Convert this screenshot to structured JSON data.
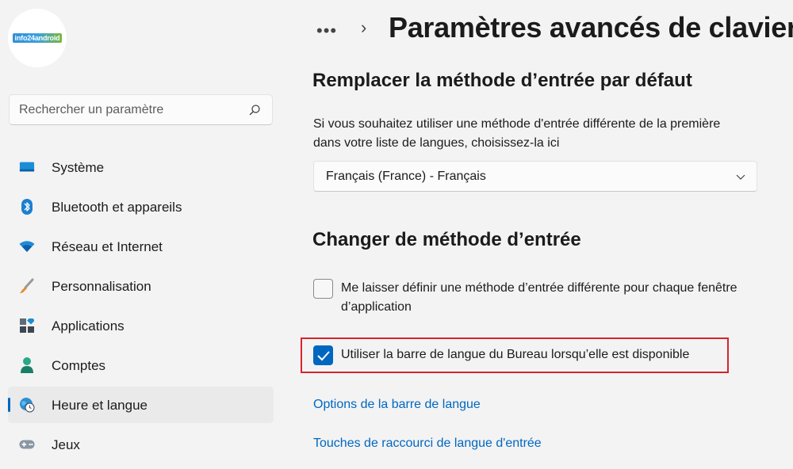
{
  "logo": {
    "text": "info24android"
  },
  "search": {
    "placeholder": "Rechercher un paramètre"
  },
  "sidebar": {
    "items": [
      {
        "label": "Système",
        "icon": "monitor-icon"
      },
      {
        "label": "Bluetooth et appareils",
        "icon": "bluetooth-icon"
      },
      {
        "label": "Réseau et Internet",
        "icon": "wifi-icon"
      },
      {
        "label": "Personnalisation",
        "icon": "brush-icon"
      },
      {
        "label": "Applications",
        "icon": "apps-icon"
      },
      {
        "label": "Comptes",
        "icon": "person-icon"
      },
      {
        "label": "Heure et langue",
        "icon": "globe-clock-icon",
        "selected": true
      },
      {
        "label": "Jeux",
        "icon": "gamepad-icon"
      }
    ]
  },
  "header": {
    "breadcrumb_dots": "•••",
    "breadcrumb_chevron": "›",
    "title": "Paramètres avancés de clavier"
  },
  "override": {
    "title": "Remplacer la méthode d’entrée par défaut",
    "description": "Si vous souhaitez utiliser une méthode d'entrée différente de la première dans votre liste de langues, choisissez-la ici",
    "dropdown_value": "Français (France) - Français"
  },
  "switching": {
    "title": "Changer de méthode d’entrée",
    "option1_label": "Me laisser définir une méthode d’entrée différente pour chaque fenêtre d’application",
    "option1_checked": false,
    "option2_label": "Utiliser la barre de langue du Bureau lorsqu’elle est disponible",
    "option2_checked": true
  },
  "links": {
    "language_bar_options": "Options de la barre de langue",
    "hotkeys": "Touches de raccourci de langue d'entrée"
  },
  "colors": {
    "accent": "#0067c0",
    "highlight": "#d8242c",
    "background": "#f3f3f3"
  }
}
